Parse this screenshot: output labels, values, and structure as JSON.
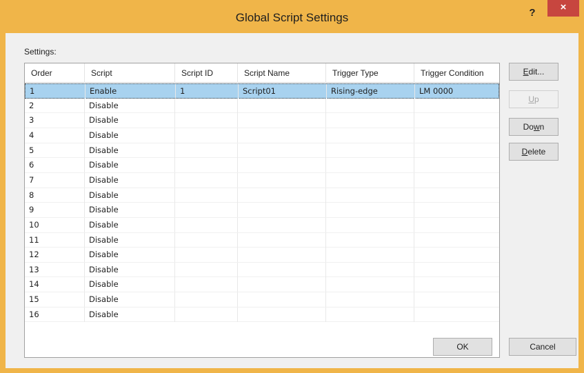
{
  "window": {
    "title": "Global Script Settings",
    "help_label": "?",
    "close_label": "×"
  },
  "settings_label": "Settings:",
  "table": {
    "columns": [
      "Order",
      "Script",
      "Script ID",
      "Script Name",
      "Trigger Type",
      "Trigger Condition"
    ],
    "rows": [
      {
        "order": "1",
        "script": "Enable",
        "script_id": "1",
        "script_name": "Script01",
        "trigger_type": "Rising-edge",
        "trigger_condition": "LM 0000",
        "selected": true
      },
      {
        "order": "2",
        "script": "Disable",
        "script_id": "",
        "script_name": "",
        "trigger_type": "",
        "trigger_condition": ""
      },
      {
        "order": "3",
        "script": "Disable",
        "script_id": "",
        "script_name": "",
        "trigger_type": "",
        "trigger_condition": ""
      },
      {
        "order": "4",
        "script": "Disable",
        "script_id": "",
        "script_name": "",
        "trigger_type": "",
        "trigger_condition": ""
      },
      {
        "order": "5",
        "script": "Disable",
        "script_id": "",
        "script_name": "",
        "trigger_type": "",
        "trigger_condition": ""
      },
      {
        "order": "6",
        "script": "Disable",
        "script_id": "",
        "script_name": "",
        "trigger_type": "",
        "trigger_condition": ""
      },
      {
        "order": "7",
        "script": "Disable",
        "script_id": "",
        "script_name": "",
        "trigger_type": "",
        "trigger_condition": ""
      },
      {
        "order": "8",
        "script": "Disable",
        "script_id": "",
        "script_name": "",
        "trigger_type": "",
        "trigger_condition": ""
      },
      {
        "order": "9",
        "script": "Disable",
        "script_id": "",
        "script_name": "",
        "trigger_type": "",
        "trigger_condition": ""
      },
      {
        "order": "10",
        "script": "Disable",
        "script_id": "",
        "script_name": "",
        "trigger_type": "",
        "trigger_condition": ""
      },
      {
        "order": "11",
        "script": "Disable",
        "script_id": "",
        "script_name": "",
        "trigger_type": "",
        "trigger_condition": ""
      },
      {
        "order": "12",
        "script": "Disable",
        "script_id": "",
        "script_name": "",
        "trigger_type": "",
        "trigger_condition": ""
      },
      {
        "order": "13",
        "script": "Disable",
        "script_id": "",
        "script_name": "",
        "trigger_type": "",
        "trigger_condition": ""
      },
      {
        "order": "14",
        "script": "Disable",
        "script_id": "",
        "script_name": "",
        "trigger_type": "",
        "trigger_condition": ""
      },
      {
        "order": "15",
        "script": "Disable",
        "script_id": "",
        "script_name": "",
        "trigger_type": "",
        "trigger_condition": ""
      },
      {
        "order": "16",
        "script": "Disable",
        "script_id": "",
        "script_name": "",
        "trigger_type": "",
        "trigger_condition": ""
      }
    ]
  },
  "buttons": {
    "edit": {
      "pre": "",
      "key": "E",
      "post": "dit..."
    },
    "up": {
      "pre": "",
      "key": "U",
      "post": "p",
      "disabled": true
    },
    "down": {
      "pre": "Do",
      "key": "w",
      "post": "n"
    },
    "delete": {
      "pre": "",
      "key": "D",
      "post": "elete"
    },
    "ok": "OK",
    "cancel": "Cancel"
  },
  "colors": {
    "titlebar": "#f0b549",
    "close": "#c7463f",
    "selection": "#a8d2ef"
  }
}
